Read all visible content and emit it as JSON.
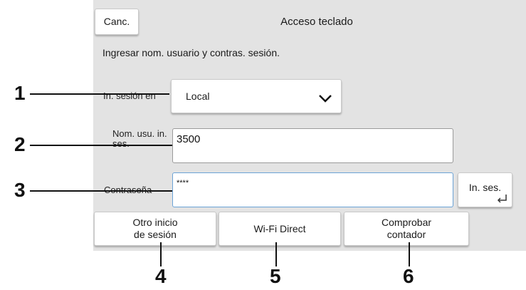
{
  "header": {
    "cancel_label": "Canc.",
    "title": "Acceso teclado"
  },
  "prompt": "Ingresar nom. usuario y contras. sesión.",
  "login_dest": {
    "label": "In. sesión en",
    "value": "Local"
  },
  "username": {
    "label": "Nom. usu. in. ses.",
    "value": "3500"
  },
  "password": {
    "label": "Contraseña",
    "value": "****"
  },
  "login_button": "In. ses.",
  "bottom_buttons": {
    "other_login": "Otro inicio de sesión",
    "wifi_direct": "Wi-Fi Direct",
    "check_counter": "Comprobar contador"
  },
  "callouts": [
    "1",
    "2",
    "3",
    "4",
    "5",
    "6"
  ],
  "colors": {
    "panel_bg": "#e3e3e3",
    "button_bg": "#ffffff",
    "active_border": "#6ba3d6"
  }
}
